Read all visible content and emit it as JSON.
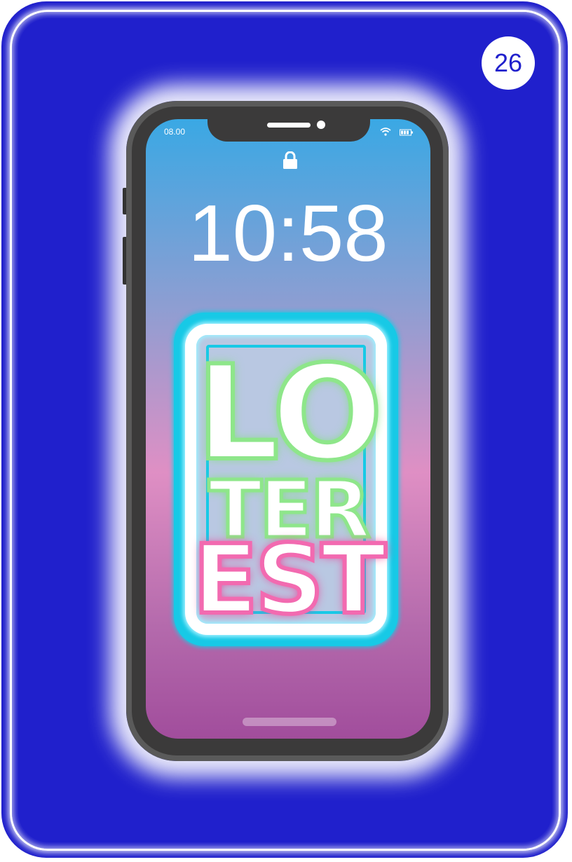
{
  "card": {
    "number": "26",
    "colors": {
      "background": "#2020cc",
      "accent": "#ffffff"
    }
  },
  "phone": {
    "status_time": "08.00",
    "status_icons": [
      "wifi-icon",
      "battery-icon"
    ],
    "lock_icon": "lock-icon",
    "clock": "10:58"
  },
  "artwork": {
    "lines": [
      "LO",
      "TER",
      "EST"
    ],
    "colors": {
      "frame": "#17c9e6",
      "green_outline": "#8ee68a",
      "pink_outline": "#f26ab0"
    }
  }
}
